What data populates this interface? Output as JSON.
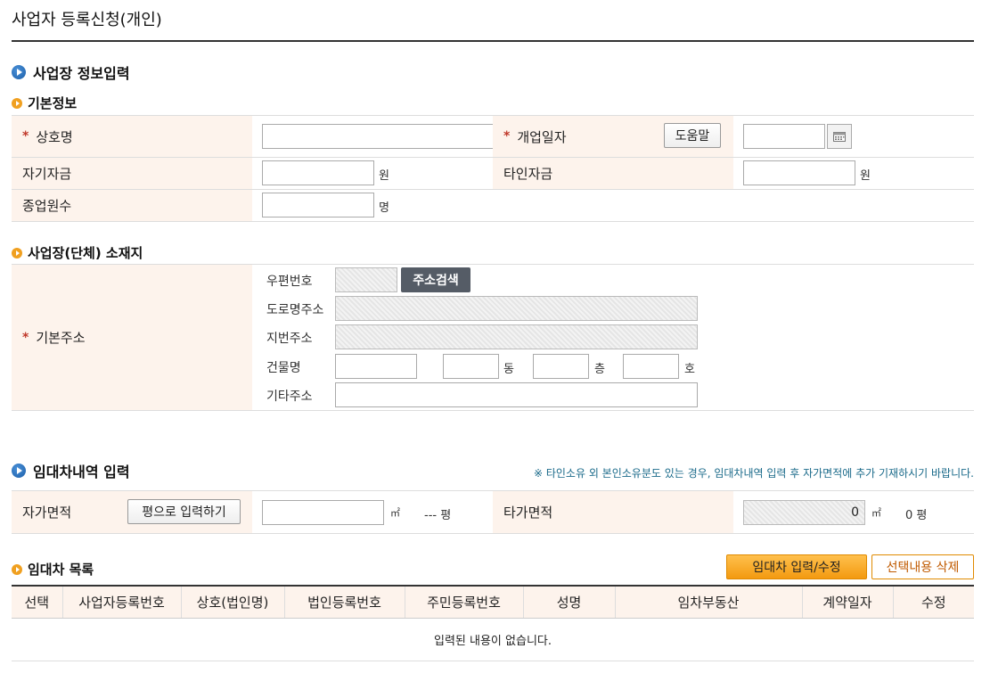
{
  "page": {
    "title": "사업자 등록신청(개인)"
  },
  "section_business": {
    "title": "사업장 정보입력",
    "basic_info": {
      "title": "기본정보",
      "trade_name_label": "상호명",
      "open_date_label": "개업일자",
      "help_button": "도움말",
      "own_capital_label": "자기자금",
      "own_capital_unit": "원",
      "other_capital_label": "타인자금",
      "other_capital_unit": "원",
      "employees_label": "종업원수",
      "employees_unit": "명"
    },
    "location": {
      "title": "사업장(단체) 소재지",
      "base_address_label": "기본주소",
      "zip_label": "우편번호",
      "search_button": "주소검색",
      "road_address_label": "도로명주소",
      "lot_address_label": "지번주소",
      "building_label": "건물명",
      "dong_unit": "동",
      "floor_unit": "층",
      "ho_unit": "호",
      "other_address_label": "기타주소"
    }
  },
  "section_lease": {
    "title": "임대차내역 입력",
    "note": "※ 타인소유 외 본인소유분도 있는 경우, 임대차내역 입력 후 자가면적에 추가 기재하시기 바랍니다.",
    "own_area_label": "자가면적",
    "pyeong_input_button": "평으로 입력하기",
    "own_area_unit": "㎡",
    "own_area_pyeong": "--- 평",
    "other_area_label": "타가면적",
    "other_area_value": "0",
    "other_area_unit": "㎡",
    "other_area_pyeong": "0 평",
    "list_title": "임대차 목록",
    "edit_button": "임대차 입력/수정",
    "delete_button": "선택내용 삭제",
    "table": {
      "columns": [
        "선택",
        "사업자등록번호",
        "상호(법인명)",
        "법인등록번호",
        "주민등록번호",
        "성명",
        "임차부동산",
        "계약일자",
        "수정"
      ],
      "empty_message": "입력된 내용이 없습니다."
    }
  }
}
